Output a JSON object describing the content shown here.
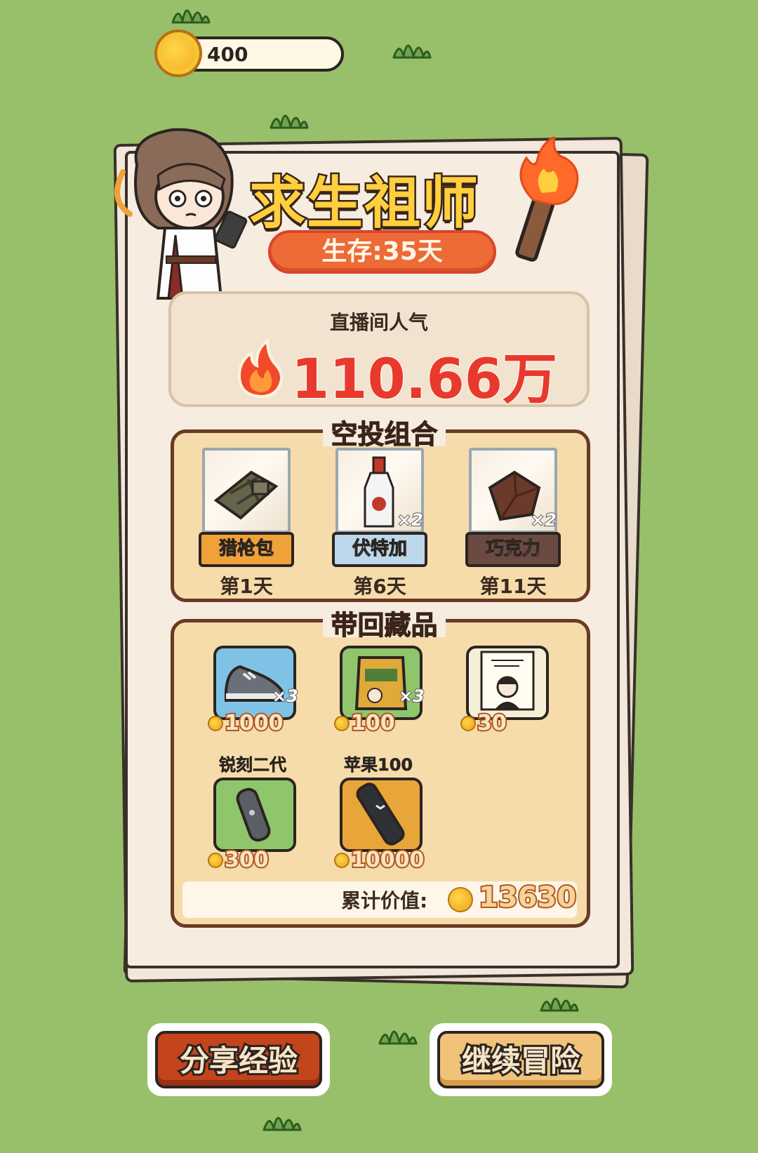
{
  "top_bar": {
    "coins": "400"
  },
  "result": {
    "title": "求生祖师",
    "survival": "生存:35天",
    "popularity_label": "直播间人气",
    "popularity_value": "110.66万"
  },
  "airdrop": {
    "title": "空投组合",
    "items": [
      {
        "name": "猎枪包",
        "day": "第1天",
        "qty": "",
        "label_color": "#f0a23a",
        "icon": "gun-bag-icon"
      },
      {
        "name": "伏特加",
        "day": "第6天",
        "qty": "×2",
        "label_color": "#bcd8ea",
        "icon": "vodka-bottle-icon"
      },
      {
        "name": "巧克力",
        "day": "第11天",
        "qty": "×2",
        "label_color": "#6b4a42",
        "icon": "chocolate-icon"
      }
    ]
  },
  "loot": {
    "title": "带回藏品",
    "items": [
      {
        "name": "",
        "price": "1000",
        "qty": "×3",
        "bg": "#7ec3e6",
        "icon": "sneaker-icon"
      },
      {
        "name": "",
        "price": "100",
        "qty": "×3",
        "bg": "#8fc66b",
        "icon": "seed-bag-icon"
      },
      {
        "name": "",
        "price": "30",
        "qty": "",
        "bg": "#f6efd8",
        "icon": "poster-icon"
      },
      {
        "name": "锐刻二代",
        "price": "300",
        "qty": "",
        "bg": "#8fc66b",
        "icon": "vape-icon"
      },
      {
        "name": "苹果100",
        "price": "10000",
        "qty": "",
        "bg": "#e8a53a",
        "icon": "phone-device-icon"
      }
    ],
    "total_label": "累计价值:",
    "total_value": "13630"
  },
  "buttons": {
    "share": "分享经验",
    "continue": "继续冒险"
  },
  "colors": {
    "background": "#98c06a",
    "share_button": "#c4441c",
    "continue_button": "#f1c27a",
    "popularity_red": "#e8392e"
  }
}
